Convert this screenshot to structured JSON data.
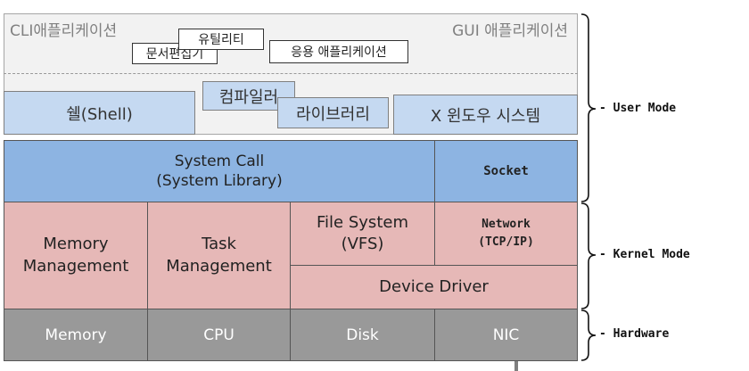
{
  "user_space": {
    "cli_label": "CLI애플리케이션",
    "gui_label": "GUI 애플리케이션",
    "apps": {
      "utility": "유틸리티",
      "text_editor": "문서편집기",
      "application": "응용 애플리케이션"
    },
    "shell": "쉘(Shell)",
    "compiler": "컴파일러",
    "library": "라이브러리",
    "x_window": "X 윈도우 시스템"
  },
  "system_call": {
    "label": "System Call\n(System Library)",
    "socket": "Socket"
  },
  "kernel": {
    "memory_management": "Memory\nManagement",
    "task_management": "Task\nManagement",
    "file_system": "File System\n(VFS)",
    "network": "Network\n(TCP/IP)",
    "device_driver": "Device Driver"
  },
  "hardware": {
    "memory": "Memory",
    "cpu": "CPU",
    "disk": "Disk",
    "nic": "NIC"
  },
  "modes": {
    "user": "User Mode",
    "kernel": "Kernel Mode",
    "hardware": "Hardware"
  }
}
